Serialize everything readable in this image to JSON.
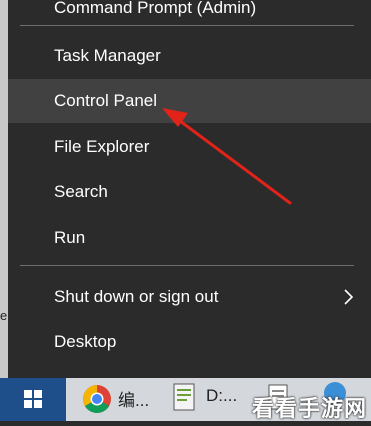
{
  "menu": {
    "items": [
      {
        "label": "Command Prompt (Admin)"
      },
      {
        "label": "Task Manager"
      },
      {
        "label": "Control Panel"
      },
      {
        "label": "File Explorer"
      },
      {
        "label": "Search"
      },
      {
        "label": "Run"
      },
      {
        "label": "Shut down or sign out"
      },
      {
        "label": "Desktop"
      }
    ]
  },
  "taskbar": {
    "app1_label": "编...",
    "app2_label": "D:..."
  },
  "left_strip_char": "e",
  "watermark": "看看手游网",
  "colors": {
    "menu_bg": "#2b2b2b",
    "hover_bg": "#414141",
    "annotation_arrow": "#e2231a",
    "start_button": "#1f4f8a"
  }
}
